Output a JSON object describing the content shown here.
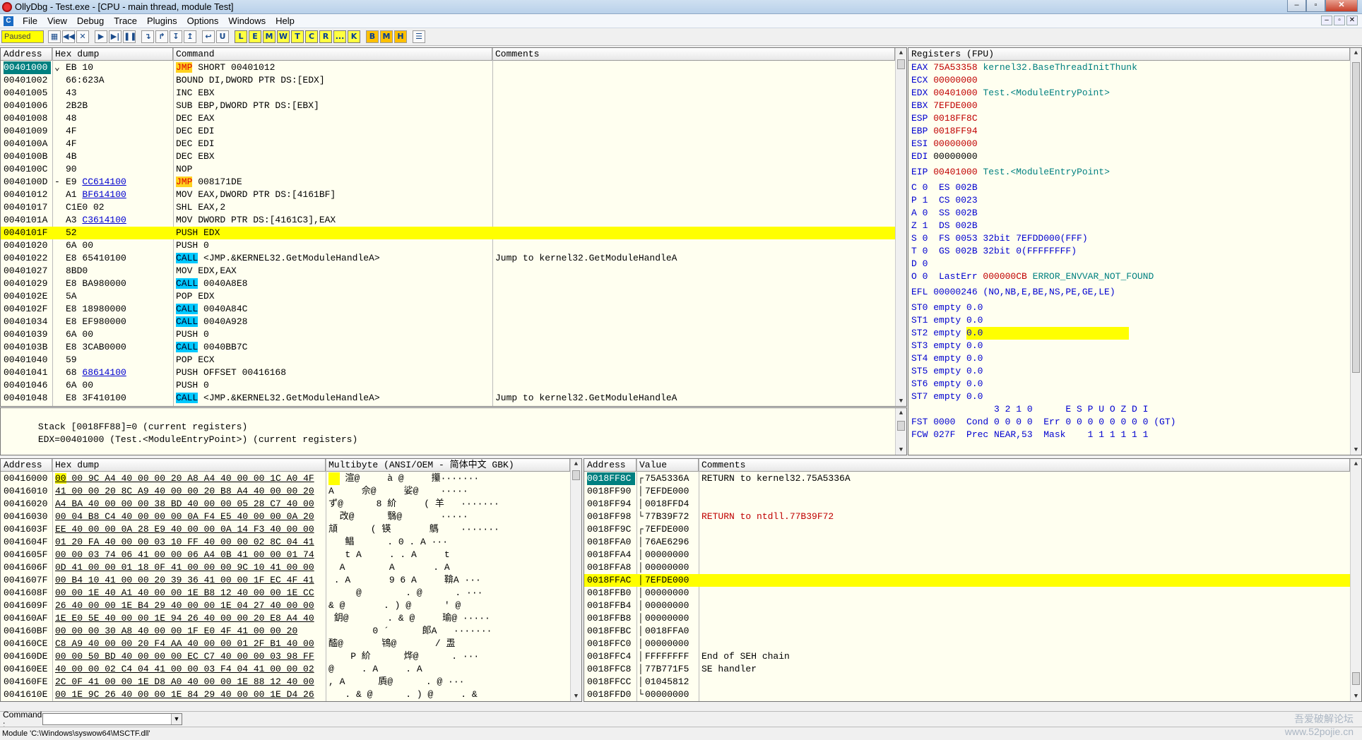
{
  "window": {
    "title": "OllyDbg - Test.exe - [CPU - main thread, module Test]",
    "min": "–",
    "max": "▫",
    "close": "✕"
  },
  "menu": [
    "File",
    "View",
    "Debug",
    "Trace",
    "Plugins",
    "Options",
    "Windows",
    "Help"
  ],
  "toolbar": {
    "state": "Paused",
    "buttons": [
      "▦",
      "◀◀",
      "✕",
      "▶",
      "▶|",
      "❚❚",
      "↴",
      "↱",
      "↧",
      "↥",
      "↩",
      "U"
    ],
    "letters": [
      "L",
      "E",
      "M",
      "W",
      "T",
      "C",
      "R",
      "...",
      "K"
    ],
    "letters2": [
      "B",
      "M",
      "H"
    ],
    "list_icon": "☰"
  },
  "disasm": {
    "headers": [
      "Address",
      "Hex dump",
      "Command",
      "Comments"
    ],
    "rows": [
      {
        "addr": "00401000",
        "mark": "⌄",
        "hex": "EB 10",
        "op": "JMP",
        "arg": " SHORT 00401012",
        "kind": "jmp",
        "comment": "",
        "sel": true
      },
      {
        "addr": "00401002",
        "mark": "",
        "hex": "66:623A",
        "op": "",
        "arg": "BOUND DI,DWORD PTR DS:[EDX]",
        "comment": ""
      },
      {
        "addr": "00401005",
        "mark": "",
        "hex": "43",
        "op": "",
        "arg": "INC EBX",
        "comment": ""
      },
      {
        "addr": "00401006",
        "mark": "",
        "hex": "2B2B",
        "op": "",
        "arg": "SUB EBP,DWORD PTR DS:[EBX]",
        "comment": ""
      },
      {
        "addr": "00401008",
        "mark": "",
        "hex": "48",
        "op": "",
        "arg": "DEC EAX",
        "comment": ""
      },
      {
        "addr": "00401009",
        "mark": "",
        "hex": "4F",
        "op": "",
        "arg": "DEC EDI",
        "comment": ""
      },
      {
        "addr": "0040100A",
        "mark": "",
        "hex": "4F",
        "op": "",
        "arg": "DEC EDI",
        "comment": ""
      },
      {
        "addr": "0040100B",
        "mark": "",
        "hex": "4B",
        "op": "",
        "arg": "DEC EBX",
        "comment": ""
      },
      {
        "addr": "0040100C",
        "mark": "",
        "hex": "90",
        "op": "",
        "arg": "NOP",
        "comment": ""
      },
      {
        "addr": "0040100D",
        "mark": "-",
        "hex": "E9 CC614100",
        "op": "JMP",
        "arg": " 008171DE",
        "kind": "jmp",
        "comment": ""
      },
      {
        "addr": "00401012",
        "mark": "",
        "hex": "A1 BF614100",
        "op": "",
        "arg": "MOV EAX,DWORD PTR DS:[4161BF]",
        "comment": ""
      },
      {
        "addr": "00401017",
        "mark": "",
        "hex": "C1E0 02",
        "op": "",
        "arg": "SHL EAX,2",
        "comment": ""
      },
      {
        "addr": "0040101A",
        "mark": "",
        "hex": "A3 C3614100",
        "op": "",
        "arg": "MOV DWORD PTR DS:[4161C3],EAX",
        "comment": ""
      },
      {
        "addr": "0040101F",
        "mark": "",
        "hex": "52",
        "op": "",
        "arg": "PUSH EDX",
        "comment": "",
        "hl": true
      },
      {
        "addr": "00401020",
        "mark": "",
        "hex": "6A 00",
        "op": "",
        "arg": "PUSH 0",
        "comment": ""
      },
      {
        "addr": "00401022",
        "mark": "",
        "hex": "E8 65410100",
        "op": "CALL",
        "arg": " <JMP.&KERNEL32.GetModuleHandleA>",
        "kind": "call",
        "comment": "Jump to kernel32.GetModuleHandleA"
      },
      {
        "addr": "00401027",
        "mark": "",
        "hex": "8BD0",
        "op": "",
        "arg": "MOV EDX,EAX",
        "comment": ""
      },
      {
        "addr": "00401029",
        "mark": "",
        "hex": "E8 BA980000",
        "op": "CALL",
        "arg": " 0040A8E8",
        "kind": "call",
        "comment": ""
      },
      {
        "addr": "0040102E",
        "mark": "",
        "hex": "5A",
        "op": "",
        "arg": "POP EDX",
        "comment": ""
      },
      {
        "addr": "0040102F",
        "mark": "",
        "hex": "E8 18980000",
        "op": "CALL",
        "arg": " 0040A84C",
        "kind": "call",
        "comment": ""
      },
      {
        "addr": "00401034",
        "mark": "",
        "hex": "E8 EF980000",
        "op": "CALL",
        "arg": " 0040A928",
        "kind": "call",
        "comment": ""
      },
      {
        "addr": "00401039",
        "mark": "",
        "hex": "6A 00",
        "op": "",
        "arg": "PUSH 0",
        "comment": ""
      },
      {
        "addr": "0040103B",
        "mark": "",
        "hex": "E8 3CAB0000",
        "op": "CALL",
        "arg": " 0040BB7C",
        "kind": "call",
        "comment": ""
      },
      {
        "addr": "00401040",
        "mark": "",
        "hex": "59",
        "op": "",
        "arg": "POP ECX",
        "comment": ""
      },
      {
        "addr": "00401041",
        "mark": "",
        "hex": "68 68614100",
        "op": "",
        "arg": "PUSH OFFSET 00416168",
        "comment": ""
      },
      {
        "addr": "00401046",
        "mark": "",
        "hex": "6A 00",
        "op": "",
        "arg": "PUSH 0",
        "comment": ""
      },
      {
        "addr": "00401048",
        "mark": "",
        "hex": "E8 3F410100",
        "op": "CALL",
        "arg": " <JMP.&KERNEL32.GetModuleHandleA>",
        "kind": "call",
        "comment": "Jump to kernel32.GetModuleHandleA"
      }
    ]
  },
  "info": [
    "Stack [0018FF88]=0 (current registers)",
    "EDX=00401000 (Test.<ModuleEntryPoint>) (current registers)"
  ],
  "registers": {
    "header": "Registers (FPU)",
    "gp": [
      {
        "n": "EAX",
        "v": "75A53358",
        "c": "kernel32.BaseThreadInitThunk",
        "red": true
      },
      {
        "n": "ECX",
        "v": "00000000",
        "c": "",
        "red": true
      },
      {
        "n": "EDX",
        "v": "00401000",
        "c": "Test.<ModuleEntryPoint>",
        "red": true
      },
      {
        "n": "EBX",
        "v": "7EFDE000",
        "c": "",
        "red": true
      },
      {
        "n": "ESP",
        "v": "0018FF8C",
        "c": "",
        "red": true
      },
      {
        "n": "EBP",
        "v": "0018FF94",
        "c": "",
        "red": true
      },
      {
        "n": "ESI",
        "v": "00000000",
        "c": "",
        "red": true
      },
      {
        "n": "EDI",
        "v": "00000000",
        "c": "",
        "red": false
      }
    ],
    "eip": {
      "n": "EIP",
      "v": "00401000",
      "c": "Test.<ModuleEntryPoint>"
    },
    "flags": [
      "C 0  ES 002B",
      "P 1  CS 0023",
      "A 0  SS 002B",
      "Z 1  DS 002B",
      "S 0  FS 0053 32bit 7EFDD000(FFF)",
      "T 0  GS 002B 32bit 0(FFFFFFFF)",
      "D 0"
    ],
    "lasterr": {
      "prefix": "O 0  LastErr ",
      "code": "000000CB",
      "name": " ERROR_ENVVAR_NOT_FOUND"
    },
    "efl": "EFL 00000246 (NO,NB,E,BE,NS,PE,GE,LE)",
    "fpu": [
      {
        "n": "ST0",
        "t": "empty",
        "v": "0.0"
      },
      {
        "n": "ST1",
        "t": "empty",
        "v": "0.0"
      },
      {
        "n": "ST2",
        "t": "empty",
        "v": "0.0",
        "hl": true
      },
      {
        "n": "ST3",
        "t": "empty",
        "v": "0.0"
      },
      {
        "n": "ST4",
        "t": "empty",
        "v": "0.0"
      },
      {
        "n": "ST5",
        "t": "empty",
        "v": "0.0"
      },
      {
        "n": "ST6",
        "t": "empty",
        "v": "0.0"
      },
      {
        "n": "ST7",
        "t": "empty",
        "v": "0.0"
      }
    ],
    "fpu_hdr": "               3 2 1 0      E S P U O Z D I",
    "fst": "FST 0000  Cond 0 0 0 0  Err 0 0 0 0 0 0 0 0 (GT)",
    "fcw": "FCW 027F  Prec NEAR,53  Mask    1 1 1 1 1 1"
  },
  "dump": {
    "headers": [
      "Address",
      "Hex dump",
      "Multibyte (ANSI/OEM - 简体中文 GBK)"
    ],
    "rows": [
      {
        "a": "00416000",
        "h": "00 00 9C A4 40 00 00 20 A8 A4 40 00 00 1C A0 4F",
        "t": "   渲@     à @     攥·······"
      },
      {
        "a": "00416010",
        "h": "41 00 00 20 8C A9 40 00 00 20 B8 A4 40 00 00 20",
        "t": "A     佘@     娑@    ·····"
      },
      {
        "a": "00416020",
        "h": "A4 BA 40 00 00 00 38 BD 40 00 00 05 28 C7 40 00",
        "t": "ず@      8 紒     ( 羊   ·······"
      },
      {
        "a": "00416030",
        "h": "00 04 B8 C4 40 00 00 00 0A F4 E5 40 00 00 0A 20",
        "t": "  改@      翳@       ·····"
      },
      {
        "a": "0041603F",
        "h": "EE 40 00 00 0A 28 E9 40 00 00 0A 14 F3 40 00 00",
        "t": "頏      ( 锳       鷌    ·······"
      },
      {
        "a": "0041604F",
        "h": "01 20 FA 40 00 00 03 10 FF 40 00 00 02 8C 04 41",
        "t": "   鲳      . 0 . A ···"
      },
      {
        "a": "0041605F",
        "h": "00 00 03 74 06 41 00 00 06 A4 0B 41 00 00 01 74",
        "t": "   t A     . . A     t"
      },
      {
        "a": "0041606F",
        "h": "0D 41 00 00 01 18 0F 41 00 00 00 9C 10 41 00 00",
        "t": "  A        A       . A"
      },
      {
        "a": "0041607F",
        "h": "00 B4 10 41 00 00 20 39 36 41 00 00 1F EC 4F 41",
        "t": " . A       9 6 A     鞥A ···"
      },
      {
        "a": "0041608F",
        "h": "00 00 1E 40 A1 40 00 00 1E B8 12 40 00 00 1E CC",
        "t": "     @        . @      . ···"
      },
      {
        "a": "0041609F",
        "h": "26 40 00 00 1E B4 29 40 00 00 1E 04 27 40 00 00",
        "t": "& @       . ) @      ' @"
      },
      {
        "a": "004160AF",
        "h": "1E E0 5E 40 00 00 1E 94 26 40 00 00 20 E8 A4 40",
        "t": " 鈅@       . & @     瑜@ ·····"
      },
      {
        "a": "004160BF",
        "h": "00 00 00 30 A8 40 00 00 1F E0 4F 41 00 00 20",
        "t": "        0 ´      郞A   ·······"
      },
      {
        "a": "004160CE",
        "h": "C8 A9 40 00 00 20 F4 AA 40 00 00 01 2F B1 40 00",
        "t": "醓@       鴇@       / 盄"
      },
      {
        "a": "004160DE",
        "h": "00 00 50 BD 40 00 00 00 EC C7 40 00 00 03 98 FF",
        "t": "    P 紒      烨@      . ···"
      },
      {
        "a": "004160EE",
        "h": "40 00 00 02 C4 04 41 00 00 03 F4 04 41 00 00 02",
        "t": "@     . A     . A      "
      },
      {
        "a": "004160FE",
        "h": "2C 0F 41 00 00 1E D8 A0 40 00 00 1E 88 12 40 00",
        "t": ", A      貭@      . @ ···"
      },
      {
        "a": "0041610E",
        "h": "00 1E 9C 26 40 00 00 1E 84 29 40 00 00 1E D4 26",
        "t": "   . & @      . ) @     . &"
      }
    ]
  },
  "stack": {
    "headers": [
      "Address",
      "Value",
      "Comments"
    ],
    "rows": [
      {
        "a": "0018FF8C",
        "v": "75A5336A",
        "c": "RETURN to kernel32.75A5336A",
        "br": "┌",
        "sel": true
      },
      {
        "a": "0018FF90",
        "v": "7EFDE000",
        "c": "",
        "br": "│"
      },
      {
        "a": "0018FF94",
        "v": "0018FFD4",
        "c": "",
        "br": "│"
      },
      {
        "a": "0018FF98",
        "v": "77B39F72",
        "c": "RETURN to ntdll.77B39F72",
        "br": "└",
        "red": true
      },
      {
        "a": "0018FF9C",
        "v": "7EFDE000",
        "c": "",
        "br": "┌"
      },
      {
        "a": "0018FFA0",
        "v": "76AE6296",
        "c": "",
        "br": "│"
      },
      {
        "a": "0018FFA4",
        "v": "00000000",
        "c": "",
        "br": "│"
      },
      {
        "a": "0018FFA8",
        "v": "00000000",
        "c": "",
        "br": "│"
      },
      {
        "a": "0018FFAC",
        "v": "7EFDE000",
        "c": "",
        "br": "│",
        "hl": true
      },
      {
        "a": "0018FFB0",
        "v": "00000000",
        "c": "",
        "br": "│"
      },
      {
        "a": "0018FFB4",
        "v": "00000000",
        "c": "",
        "br": "│"
      },
      {
        "a": "0018FFB8",
        "v": "00000000",
        "c": "",
        "br": "│"
      },
      {
        "a": "0018FFBC",
        "v": "0018FFA0",
        "c": "",
        "br": "│"
      },
      {
        "a": "0018FFC0",
        "v": "00000000",
        "c": "",
        "br": "│"
      },
      {
        "a": "0018FFC4",
        "v": "FFFFFFFF",
        "c": "End of SEH chain",
        "br": "│"
      },
      {
        "a": "0018FFC8",
        "v": "77B771F5",
        "c": "SE handler",
        "br": "│"
      },
      {
        "a": "0018FFCC",
        "v": "01045812",
        "c": "",
        "br": "│"
      },
      {
        "a": "0018FFD0",
        "v": "00000000",
        "c": "",
        "br": "└"
      }
    ]
  },
  "command": {
    "label": "Command :",
    "value": ""
  },
  "module": "Module 'C:\\Windows\\syswow64\\MSCTF.dll'",
  "watermark": "吾爱破解论坛\nwww.52pojie.cn"
}
